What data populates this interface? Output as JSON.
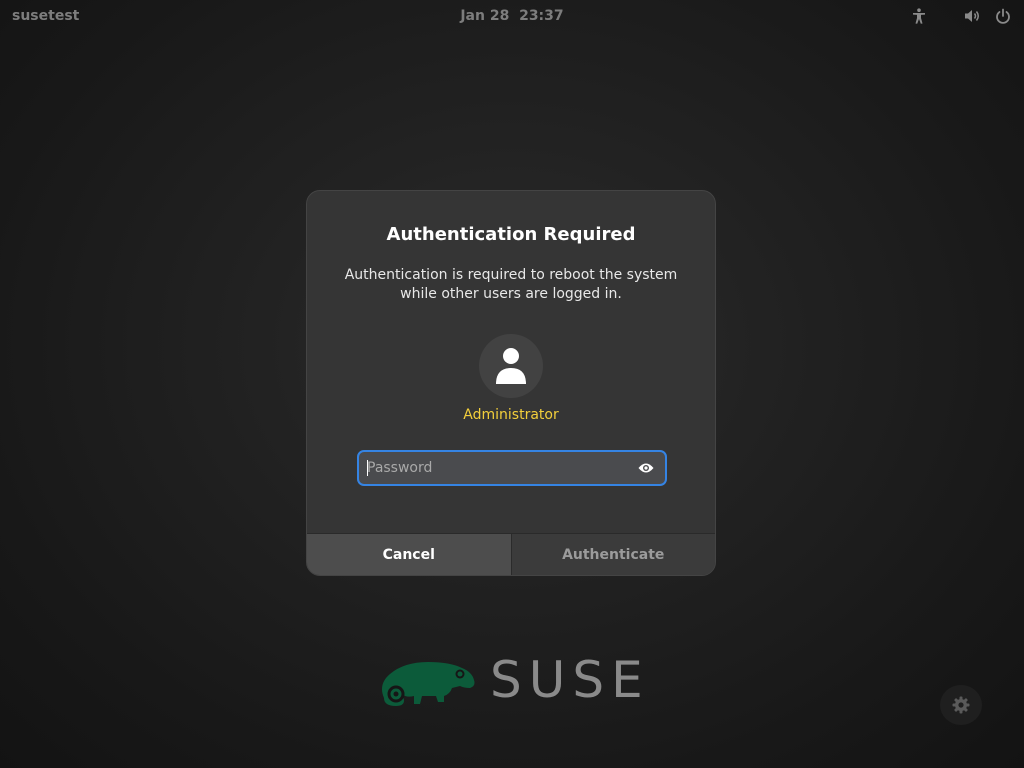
{
  "topbar": {
    "hostname": "susetest",
    "clock": "Jan 28  23:37"
  },
  "dialog": {
    "title": "Authentication Required",
    "message_line1": "Authentication is required to reboot the system",
    "message_line2": "while other users are logged in.",
    "user": "Administrator",
    "password_placeholder": "Password",
    "password_value": "",
    "cancel_label": "Cancel",
    "authenticate_label": "Authenticate"
  },
  "logo": {
    "wordmark": "SUSE"
  },
  "icons": {
    "accessibility": "accessibility-icon",
    "volume": "volume-icon",
    "power": "power-icon",
    "avatar": "user-avatar-icon",
    "reveal": "eye-icon",
    "settings": "gear-icon"
  },
  "colors": {
    "accent": "#3584e4",
    "username": "#f3cf3b",
    "logo_green": "#0c5b3a"
  }
}
